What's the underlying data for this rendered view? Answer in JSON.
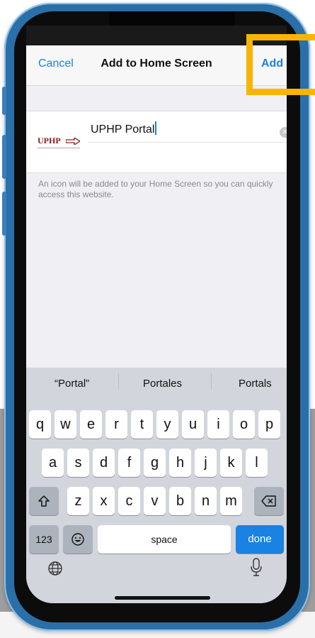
{
  "nav": {
    "cancel_label": "Cancel",
    "title": "Add to Home Screen",
    "add_label": "Add"
  },
  "site": {
    "icon_text": "UPHP",
    "title_value": "UPHP Portal"
  },
  "description": "An icon will be added to your Home Screen so you can quickly access this website.",
  "keyboard": {
    "suggestions": [
      "“Portal”",
      "Portales",
      "Portals"
    ],
    "row1": [
      "q",
      "w",
      "e",
      "r",
      "t",
      "y",
      "u",
      "i",
      "o",
      "p"
    ],
    "row2": [
      "a",
      "s",
      "d",
      "f",
      "g",
      "h",
      "j",
      "k",
      "l"
    ],
    "row3": [
      "z",
      "x",
      "c",
      "v",
      "b",
      "n",
      "m"
    ],
    "numbers_label": "123",
    "space_label": "space",
    "done_label": "done"
  },
  "colors": {
    "accent": "#1a82e2",
    "highlight": "#f7b500",
    "phone_frame": "#2a6fa8"
  },
  "icons": [
    "shift-icon",
    "backspace-icon",
    "emoji-icon",
    "globe-icon",
    "mic-icon",
    "clear-icon"
  ]
}
